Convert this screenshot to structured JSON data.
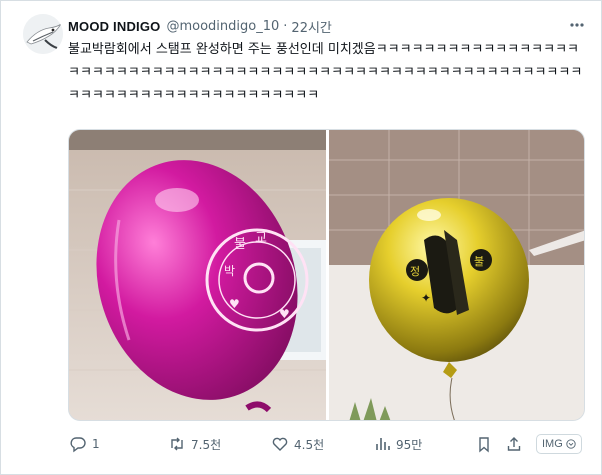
{
  "tweet": {
    "display_name": "MOOD INDIGO",
    "handle": "@moodindigo_10",
    "separator": "·",
    "time": "22시간",
    "more_icon": "more-dots-icon",
    "text": "불교박람회에서 스탬프 완성하면 주는 풍선인데 미치겠음ㅋㅋㅋㅋㅋㅋㅋㅋㅋㅋㅋㅋㅋㅋㅋㅋㅋㅋㅋㅋㅋㅋㅋㅋㅋㅋㅋㅋㅋㅋㅋㅋㅋㅋㅋㅋㅋㅋㅋㅋㅋㅋㅋㅋㅋㅋㅋㅋㅋㅋㅋㅋㅋㅋㅋㅋㅋㅋㅋㅋㅋㅋㅋㅋㅋㅋㅋㅋㅋㅋㅋㅋㅋㅋㅋㅋㅋㅋㅋㅋㅋ",
    "media": [
      {
        "kind": "pink-balloon-photo"
      },
      {
        "kind": "gold-balloon-photo"
      }
    ],
    "actions": {
      "replies": "1",
      "retweets": "7.5천",
      "likes": "4.5천",
      "views": "95만",
      "img_badge": "IMG"
    }
  },
  "colors": {
    "text": "#0f1419",
    "muted": "#536471",
    "border": "#d7dee3",
    "balloon_pink": "#d11a9c",
    "balloon_gold": "#c9b21a"
  }
}
